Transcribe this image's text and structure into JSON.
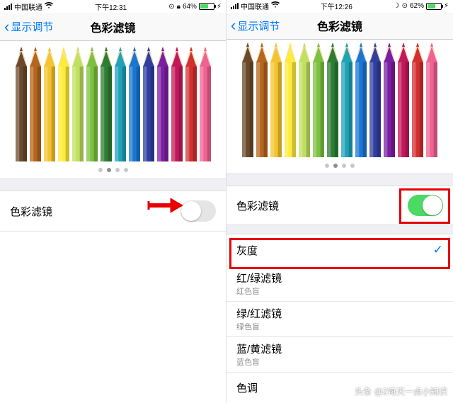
{
  "left": {
    "status": {
      "carrier": "中国联通",
      "wifi_icon": "wifi-icon",
      "time": "下午12:31",
      "alarm_icon": "alarm-icon",
      "lock_icon": "lock-icon",
      "battery_pct": "64%",
      "battery_fill": 64
    },
    "nav": {
      "back": "显示调节",
      "title": "色彩滤镜"
    },
    "toggle_row": {
      "label": "色彩滤镜",
      "on": false
    },
    "arrow_color": "#e60000"
  },
  "right": {
    "status": {
      "carrier": "中国联通",
      "wifi_icon": "wifi-icon",
      "time": "下午12:26",
      "alarm_icon": "alarm-icon",
      "lock_icon": "lock-icon",
      "battery_pct": "62%",
      "battery_fill": 62
    },
    "nav": {
      "back": "显示调节",
      "title": "色彩滤镜"
    },
    "toggle_row": {
      "label": "色彩滤镜",
      "on": true
    },
    "options": [
      {
        "label": "灰度",
        "sub": "",
        "checked": true
      },
      {
        "label": "红/绿滤镜",
        "sub": "红色盲",
        "checked": false
      },
      {
        "label": "绿/红滤镜",
        "sub": "绿色盲",
        "checked": false
      },
      {
        "label": "蓝/黄滤镜",
        "sub": "蓝色盲",
        "checked": false
      },
      {
        "label": "色调",
        "sub": "",
        "checked": false
      }
    ]
  },
  "pencil_colors": [
    "#6b4a2b",
    "#b5651d",
    "#f4c430",
    "#ffeb3b",
    "#c0e060",
    "#7cc040",
    "#2e7d32",
    "#1fa2b8",
    "#1976d2",
    "#303f9f",
    "#7b1fa2",
    "#c2185b",
    "#d32f2f",
    "#f06292"
  ],
  "pencil_colors_gray": [
    "#6a6a6a",
    "#8a8a8a",
    "#b0b0b0",
    "#d0d0d0",
    "#bcbcbc",
    "#9a9a9a",
    "#707070",
    "#888888",
    "#787878",
    "#606060",
    "#747474",
    "#808080",
    "#7c7c7c",
    "#a0a0a0"
  ],
  "watermark": "头条 @Z每天一点小知识",
  "highlights": {
    "left_arrow": true,
    "right_switch_box": true,
    "right_first_option_box": true
  }
}
